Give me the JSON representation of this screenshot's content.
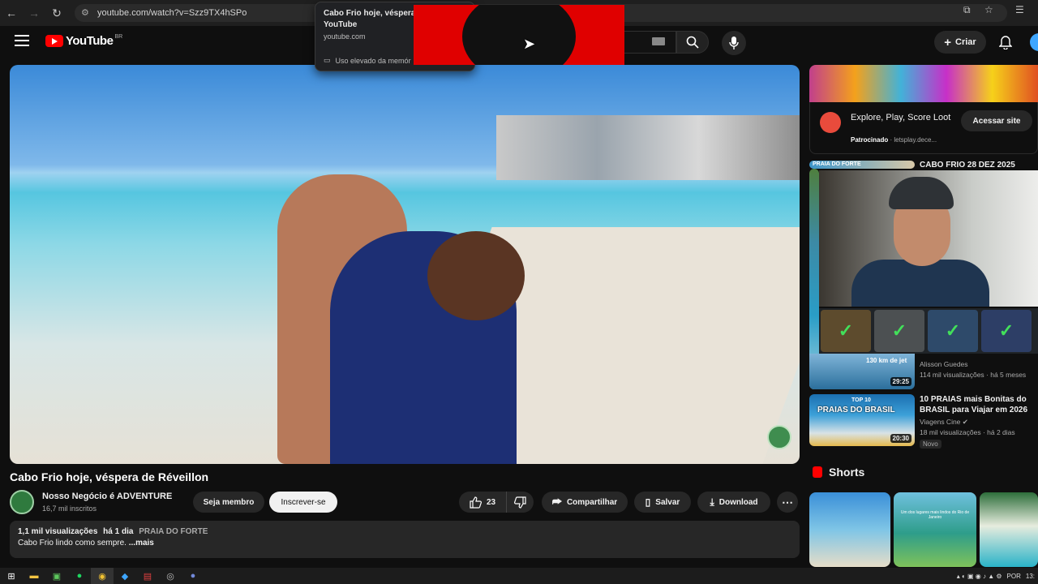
{
  "browser": {
    "url": "youtube.com/watch?v=Szz9TX4hSPo",
    "tab_tooltip": {
      "title": "Cabo Frio hoje, véspera d",
      "title_line2": "YouTube",
      "site": "youtube.com",
      "memory": "Uso elevado da memór"
    }
  },
  "header": {
    "logo_text": "YouTube",
    "country": "BR",
    "create_label": "Criar"
  },
  "video": {
    "title": "Cabo Frio hoje, véspera de Réveillon",
    "channel": "Nosso Negócio é ADVENTURE",
    "subscribers": "16,7 mil inscritos",
    "join_label": "Seja membro",
    "subscribe_label": "Inscrever-se",
    "likes": "23",
    "share_label": "Compartilhar",
    "save_label": "Salvar",
    "download_label": "Download",
    "views": "1,1 mil visualizações",
    "age": "há 1 dia",
    "location_tag": "PRAIA DO FORTE",
    "description": "Cabo Frio lindo como sempre.",
    "more": "...mais"
  },
  "ad": {
    "title": "Explore, Play, Score Loot",
    "sponsored": "Patrocinado",
    "domain": "letsplay.dece...",
    "button": "Acessar site"
  },
  "related": [
    {
      "title": "CABO FRIO 28 DEZ 2025",
      "thumb_label": "PRAIA DO FORTE"
    },
    {
      "thumb_label": "130 km de jet",
      "duration": "29:25",
      "channel": "Alisson Guedes",
      "meta": "114 mil visualizações · há 5 meses"
    },
    {
      "title": "10 PRAIAS mais Bonitas do BRASIL para Viajar em 2026",
      "thumb_label": "PRAIAS DO BRASIL",
      "thumb_top": "TOP 10",
      "duration": "20:30",
      "channel": "Viagens Cine",
      "meta": "18 mil visualizações · há 2 dias",
      "badge": "Novo"
    }
  ],
  "shorts": {
    "heading": "Shorts",
    "items": [
      {
        "label": ""
      },
      {
        "label": "Um dos lugares mais lindos do Rio de Janeiro"
      },
      {
        "label": ""
      }
    ]
  },
  "taskbar": {
    "language": "POR",
    "clock": "13:"
  },
  "colors": {
    "brand": "#ff0000",
    "background": "#0f0f0f",
    "surface": "#272727"
  }
}
